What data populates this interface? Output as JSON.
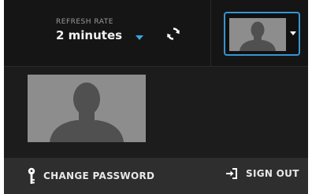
{
  "header": {
    "refresh_caption": "REFRESH RATE",
    "refresh_value": "2 minutes",
    "refresh_icon": "refresh-icon",
    "account_icon": "user-silhouette-icon"
  },
  "footer": {
    "change_password_label": "CHANGE PASSWORD",
    "change_password_icon": "key-icon",
    "sign_out_label": "SIGN OUT",
    "sign_out_icon": "sign-out-icon"
  },
  "colors": {
    "accent": "#35a7df",
    "avatar_border": "#3595d3",
    "background": "#1c1c1c",
    "footer": "#2e2e2e",
    "text": "#e8e8e8"
  }
}
